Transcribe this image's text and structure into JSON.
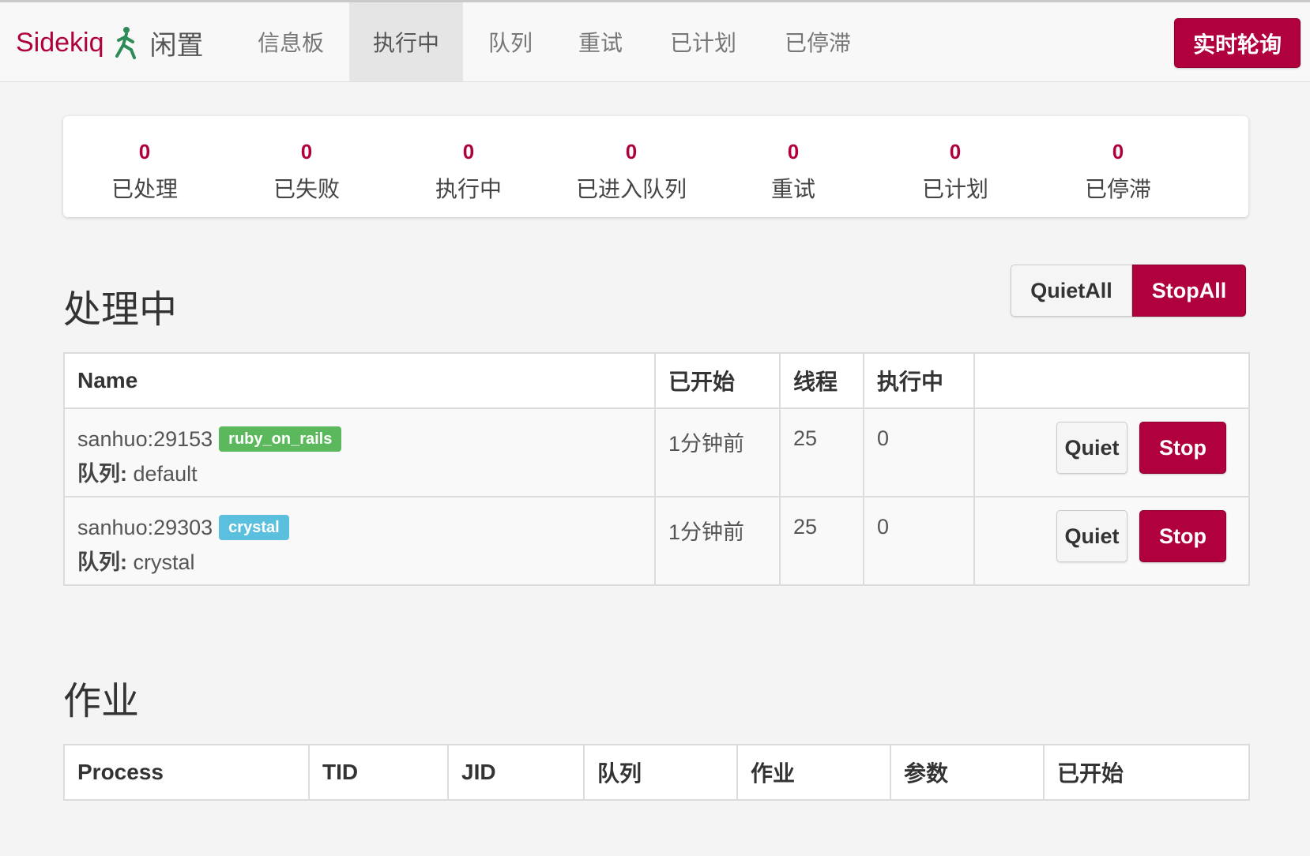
{
  "nav": {
    "brand": "Sidekiq",
    "status": "闲置",
    "items": [
      {
        "label": "信息板"
      },
      {
        "label": "执行中"
      },
      {
        "label": "队列"
      },
      {
        "label": "重试"
      },
      {
        "label": "已计划"
      },
      {
        "label": "已停滞"
      }
    ],
    "active_index": 1,
    "poll_button": "实时轮询"
  },
  "summary": {
    "stats": [
      {
        "count": "0",
        "label": "已处理"
      },
      {
        "count": "0",
        "label": "已失败"
      },
      {
        "count": "0",
        "label": "执行中"
      },
      {
        "count": "0",
        "label": "已进入队列"
      },
      {
        "count": "0",
        "label": "重试"
      },
      {
        "count": "0",
        "label": "已计划"
      },
      {
        "count": "0",
        "label": "已停滞"
      }
    ]
  },
  "processes": {
    "title": "处理中",
    "quiet_all": "QuietAll",
    "stop_all": "StopAll",
    "headers": [
      "Name",
      "已开始",
      "线程",
      "执行中",
      ""
    ],
    "queue_prefix": "队列:",
    "quiet_label": "Quiet",
    "stop_label": "Stop",
    "rows": [
      {
        "host": "sanhuo:29153",
        "tag": "ruby_on_rails",
        "tag_color": "#5cb85c",
        "queues": "default",
        "started": "1分钟前",
        "threads": "25",
        "busy": "0"
      },
      {
        "host": "sanhuo:29303",
        "tag": "crystal",
        "tag_color": "#5bc0de",
        "queues": "crystal",
        "started": "1分钟前",
        "threads": "25",
        "busy": "0"
      }
    ]
  },
  "jobs": {
    "title": "作业",
    "headers": [
      "Process",
      "TID",
      "JID",
      "队列",
      "作业",
      "参数",
      "已开始"
    ]
  },
  "colors": {
    "accent": "#b1003e",
    "tag_green": "#5cb85c",
    "tag_blue": "#5bc0de"
  }
}
